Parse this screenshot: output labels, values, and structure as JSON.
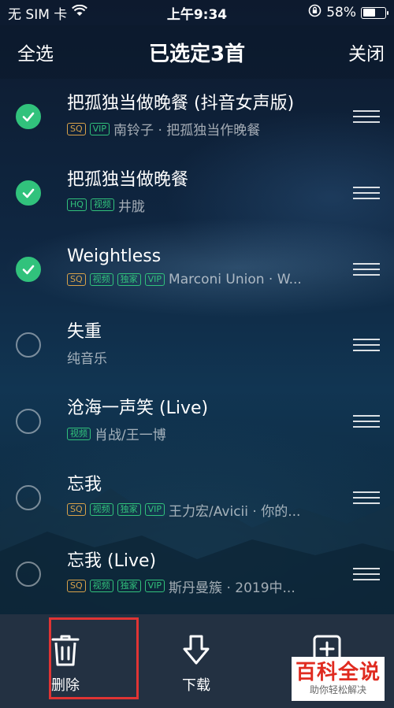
{
  "status": {
    "carrier": "无 SIM 卡",
    "time": "上午9:34",
    "battery": "58%",
    "battery_level": 0.58
  },
  "nav": {
    "select_all": "全选",
    "title": "已选定3首",
    "close": "关闭"
  },
  "songs": [
    {
      "title": "把孤独当做晚餐 (抖音女声版)",
      "badges": [
        "SQ",
        "VIP"
      ],
      "meta": "南铃子 · 把孤独当作晚餐",
      "checked": true
    },
    {
      "title": "把孤独当做晚餐",
      "badges": [
        "HQ",
        "视频"
      ],
      "meta": "井胧",
      "checked": true
    },
    {
      "title": "Weightless",
      "badges": [
        "SQ",
        "视频",
        "独家",
        "VIP"
      ],
      "meta": "Marconi Union · W...",
      "checked": true
    },
    {
      "title": "失重",
      "badges": [],
      "meta": "纯音乐",
      "checked": false
    },
    {
      "title": "沧海一声笑 (Live)",
      "badges": [
        "视频"
      ],
      "meta": "肖战/王一博",
      "checked": false
    },
    {
      "title": "忘我",
      "badges": [
        "SQ",
        "视频",
        "独家",
        "VIP"
      ],
      "meta": "王力宏/Avicii · 你的...",
      "checked": false
    },
    {
      "title": "忘我 (Live)",
      "badges": [
        "SQ",
        "视频",
        "独家",
        "VIP"
      ],
      "meta": "斯丹曼簇 · 2019中...",
      "checked": false
    }
  ],
  "actions": {
    "delete": "删除",
    "download": "下载",
    "add_partial": "添"
  },
  "watermark": {
    "title": "百科全说",
    "subtitle": "助你轻松解决"
  },
  "colors": {
    "accent": "#31c27c",
    "sq_badge": "#d8a24a",
    "highlight": "#e03434"
  }
}
